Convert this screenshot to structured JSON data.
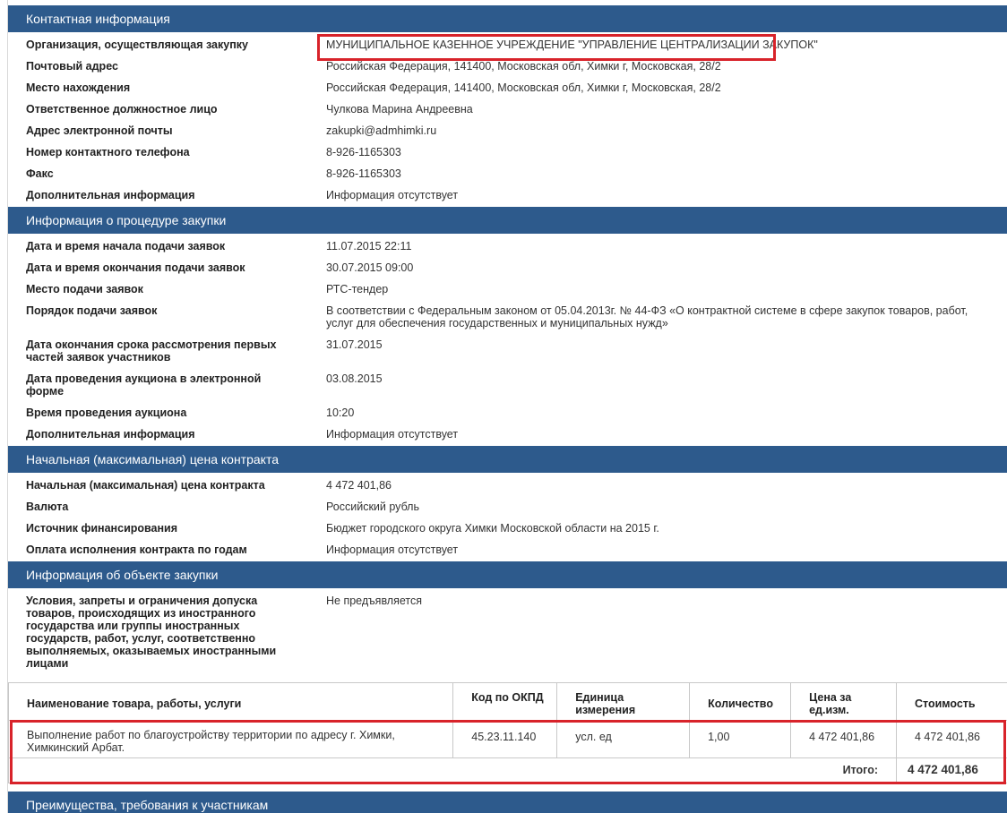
{
  "sections": {
    "contact": {
      "title": "Контактная информация",
      "rows": [
        {
          "label": "Организация, осуществляющая закупку",
          "value": "МУНИЦИПАЛЬНОЕ КАЗЕННОЕ УЧРЕЖДЕНИЕ \"УПРАВЛЕНИЕ ЦЕНТРАЛИЗАЦИИ ЗАКУПОК\""
        },
        {
          "label": "Почтовый адрес",
          "value": "Российская Федерация, 141400, Московская обл, Химки г, Московская, 28/2"
        },
        {
          "label": "Место нахождения",
          "value": "Российская Федерация, 141400, Московская обл, Химки г, Московская, 28/2"
        },
        {
          "label": "Ответственное должностное лицо",
          "value": "Чулкова Марина Андреевна"
        },
        {
          "label": "Адрес электронной почты",
          "value": "zakupki@admhimki.ru"
        },
        {
          "label": "Номер контактного телефона",
          "value": "8-926-1165303"
        },
        {
          "label": "Факс",
          "value": "8-926-1165303"
        },
        {
          "label": "Дополнительная информация",
          "value": "Информация отсутствует"
        }
      ]
    },
    "procedure": {
      "title": "Информация о процедуре закупки",
      "rows": [
        {
          "label": "Дата и время начала подачи заявок",
          "value": "11.07.2015 22:11"
        },
        {
          "label": "Дата и время окончания подачи заявок",
          "value": "30.07.2015 09:00"
        },
        {
          "label": "Место подачи заявок",
          "value": "РТС-тендер"
        },
        {
          "label": "Порядок подачи заявок",
          "value": "В соответствии с Федеральным законом от 05.04.2013г. № 44-ФЗ «О контрактной системе в сфере закупок товаров, работ, услуг для обеспечения государственных и муниципальных нужд»"
        },
        {
          "label": "Дата окончания срока рассмотрения первых частей заявок участников",
          "value": "31.07.2015"
        },
        {
          "label": "Дата проведения аукциона в электронной форме",
          "value": "03.08.2015"
        },
        {
          "label": "Время проведения аукциона",
          "value": "10:20"
        },
        {
          "label": "Дополнительная информация",
          "value": "Информация отсутствует"
        }
      ]
    },
    "price": {
      "title": "Начальная (максимальная) цена контракта",
      "rows": [
        {
          "label": "Начальная (максимальная) цена контракта",
          "value": "4 472 401,86"
        },
        {
          "label": "Валюта",
          "value": "Российский рубль"
        },
        {
          "label": "Источник финансирования",
          "value": "Бюджет городского округа Химки Московской области на 2015 г."
        },
        {
          "label": "Оплата исполнения контракта по годам",
          "value": "Информация отсутствует"
        }
      ]
    },
    "object": {
      "title": "Информация об объекте закупки",
      "rows": [
        {
          "label": "Условия, запреты и ограничения допуска товаров, происходящих из иностранного государства или группы иностранных государств, работ, услуг, соответственно выполняемых, оказываемых иностранными лицами",
          "value": "Не предъявляется"
        }
      ]
    },
    "advantages": {
      "title": "Преимущества, требования к участникам"
    }
  },
  "items_table": {
    "headers": [
      "Наименование товара, работы, услуги",
      "Код по ОКПД",
      "Единица измерения",
      "Количество",
      "Цена за ед.изм.",
      "Стоимость"
    ],
    "rows": [
      [
        "Выполнение работ по благоустройству территории по адресу г. Химки, Химкинский Арбат.",
        "45.23.11.140",
        "усл. ед",
        "1,00",
        "4 472 401,86",
        "4 472 401,86"
      ]
    ],
    "total_label": "Итого:",
    "total_value": "4 472 401,86"
  },
  "colors": {
    "header_bg": "#2d5a8c",
    "highlight": "#d8232a"
  }
}
